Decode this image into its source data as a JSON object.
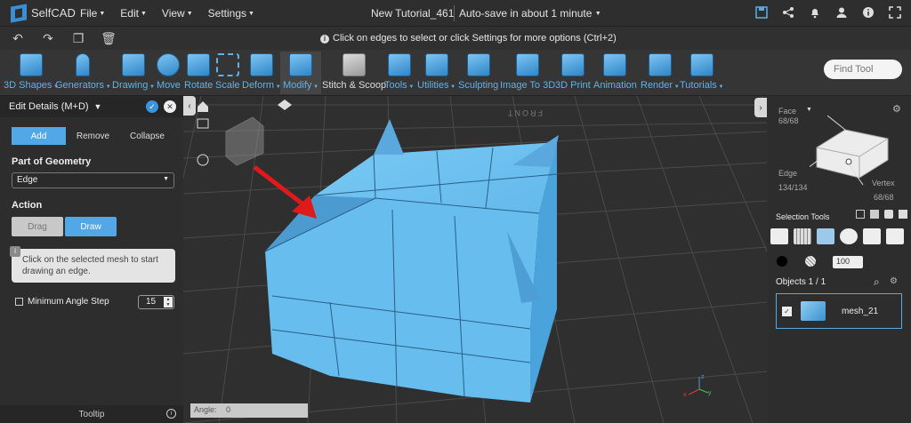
{
  "app": {
    "logo_text": "SelfCAD"
  },
  "menu": [
    "File",
    "Edit",
    "View",
    "Settings"
  ],
  "document": {
    "title": "New Tutorial_461",
    "autosave": "Auto-save in about 1 minute"
  },
  "hint": "Click on edges to select or click Settings for more options (Ctrl+2)",
  "toolbar": [
    {
      "label": "3D Shapes",
      "caret": true
    },
    {
      "label": "Generators",
      "caret": true
    },
    {
      "label": "Drawing",
      "caret": true
    },
    {
      "label": "Move",
      "caret": false
    },
    {
      "label": "Rotate",
      "caret": false
    },
    {
      "label": "Scale",
      "caret": false
    },
    {
      "label": "Deform",
      "caret": true
    },
    {
      "label": "Modify",
      "caret": true
    },
    {
      "label": "Stitch & Scoop",
      "caret": false
    },
    {
      "label": "Tools",
      "caret": true
    },
    {
      "label": "Utilities",
      "caret": true
    },
    {
      "label": "Sculpting",
      "caret": false
    },
    {
      "label": "Image To 3D",
      "caret": false
    },
    {
      "label": "3D Print",
      "caret": false
    },
    {
      "label": "Animation",
      "caret": false
    },
    {
      "label": "Render",
      "caret": true
    },
    {
      "label": "Tutorials",
      "caret": true
    }
  ],
  "find_placeholder": "Find Tool",
  "left_panel": {
    "title": "Edit Details (M+D)",
    "modes": [
      "Add",
      "Remove",
      "Collapse"
    ],
    "part_label": "Part of Geometry",
    "part_value": "Edge",
    "action_label": "Action",
    "drag_label": "Drag",
    "draw_label": "Draw",
    "tip": "Click on the selected mesh to start drawing an edge.",
    "min_angle_label": "Minimum Angle Step",
    "min_angle_value": "15",
    "tooltip_label": "Tooltip"
  },
  "viewport": {
    "angle_label": "Angle:",
    "angle_value": "0",
    "front_label": "FRONT"
  },
  "right_panel": {
    "face_label": "Face",
    "face_count": "68/68",
    "edge_label": "Edge",
    "edge_count": "134/134",
    "vertex_label": "Vertex",
    "vertex_count": "68/68",
    "selection_tools_label": "Selection Tools",
    "size_value": "100",
    "objects_label": "Objects 1 / 1",
    "object_name": "mesh_21"
  },
  "colors": {
    "accent": "#52a8e6",
    "mesh": "#6ec0ef",
    "arrow": "#e0191b"
  }
}
